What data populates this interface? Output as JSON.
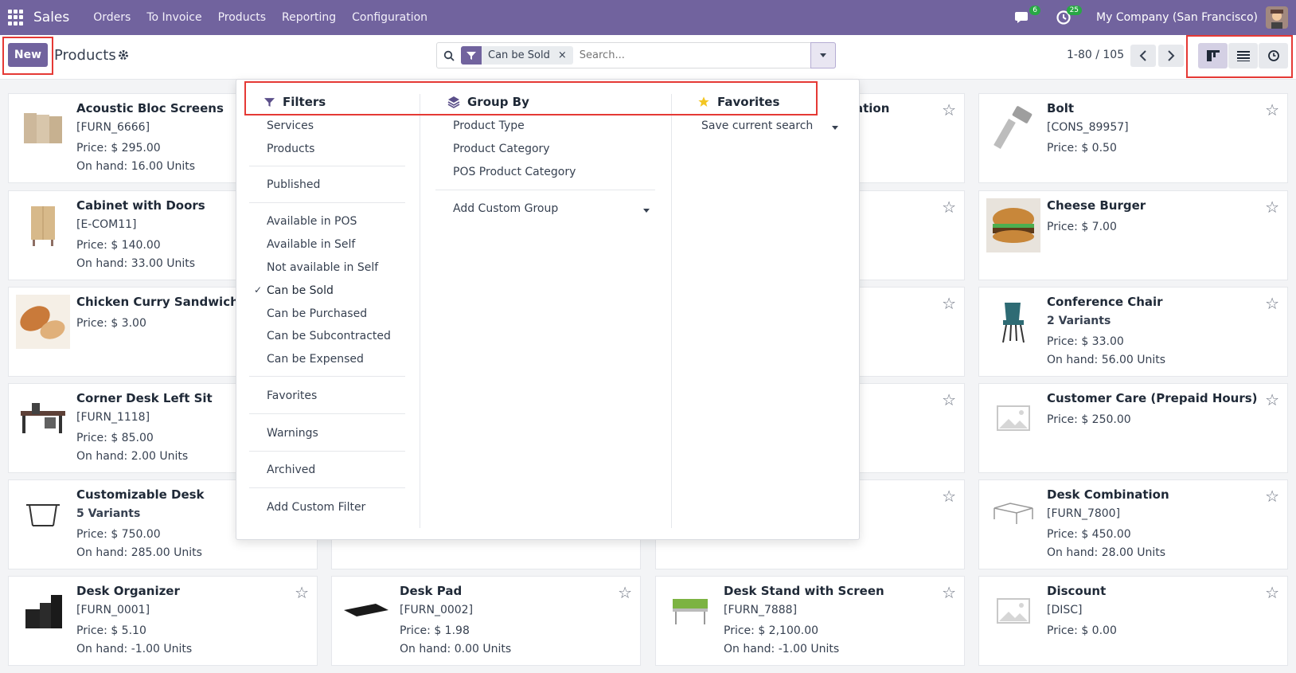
{
  "navbar": {
    "app_name": "Sales",
    "menu": [
      "Orders",
      "To Invoice",
      "Products",
      "Reporting",
      "Configuration"
    ],
    "messages_count": "6",
    "activities_count": "25",
    "company": "My Company (San Francisco)"
  },
  "control": {
    "new_label": "New",
    "title": "Products",
    "facet_label": "Can be Sold",
    "facet_remove": "×",
    "search_placeholder": "Search...",
    "pager": "1-80 / 105"
  },
  "dropdown": {
    "filters_title": "Filters",
    "groupby_title": "Group By",
    "favorites_title": "Favorites",
    "filters": {
      "services": "Services",
      "products": "Products",
      "published": "Published",
      "available_pos": "Available in POS",
      "available_self": "Available in Self",
      "not_available_self": "Not available in Self",
      "can_be_sold": "Can be Sold",
      "can_be_purchased": "Can be Purchased",
      "can_be_subcontracted": "Can be Subcontracted",
      "can_be_expensed": "Can be Expensed",
      "favorites": "Favorites",
      "warnings": "Warnings",
      "archived": "Archived",
      "add_custom_filter": "Add Custom Filter"
    },
    "groupby": {
      "product_type": "Product Type",
      "product_category": "Product Category",
      "pos_product_category": "POS Product Category",
      "add_custom_group": "Add Custom Group"
    },
    "favorites": {
      "save_current_search": "Save current search"
    },
    "check_mark": "✓"
  },
  "cards": {
    "c1": {
      "title": "Acoustic Bloc Screens",
      "ref": "[FURN_6666]",
      "price": "Price: $ 295.00",
      "onhand": "On hand: 16.00 Units"
    },
    "c2": {
      "title": "Bolt",
      "ref": "[CONS_89957]",
      "price": "Price: $ 0.50"
    },
    "c3": {
      "title": "Cabinet with Doors",
      "ref": "[E-COM11]",
      "price": "Price: $ 140.00",
      "onhand": "On hand: 33.00 Units"
    },
    "c4": {
      "title": "Cheese Burger",
      "price": "Price: $ 7.00"
    },
    "c5": {
      "title": "Chicken Curry Sandwich",
      "price": "Price: $ 3.00"
    },
    "c6": {
      "title": "Conference Chair",
      "variants": "2 Variants",
      "price": "Price: $ 33.00",
      "onhand": "On hand: 56.00 Units"
    },
    "c7": {
      "title": "Corner Desk Left Sit",
      "ref": "[FURN_1118]",
      "price": "Price: $ 85.00",
      "onhand": "On hand: 2.00 Units"
    },
    "c8": {
      "title": "Customer Care (Prepaid Hours)",
      "price": "Price: $ 250.00"
    },
    "c9": {
      "title": "Customizable Desk",
      "variants": "5 Variants",
      "price": "Price: $ 750.00",
      "onhand": "On hand: 285.00 Units"
    },
    "c10": {
      "title": "Desk Combination",
      "ref": "[FURN_7800]",
      "price": "Price: $ 450.00",
      "onhand": "On hand: 28.00 Units"
    },
    "c11": {
      "title": "Desk Organizer",
      "ref": "[FURN_0001]",
      "price": "Price: $ 5.10",
      "onhand": "On hand: -1.00 Units"
    },
    "c12": {
      "title": "Desk Pad",
      "ref": "[FURN_0002]",
      "price": "Price: $ 1.98",
      "onhand": "On hand: 0.00 Units"
    },
    "c13": {
      "title": "Desk Stand with Screen",
      "ref": "[FURN_7888]",
      "price": "Price: $ 2,100.00",
      "onhand": "On hand: -1.00 Units"
    },
    "c14": {
      "title": "Discount",
      "ref": "[DISC]",
      "price": "Price: $ 0.00"
    },
    "partial_title": "ation"
  },
  "colors": {
    "brand": "#71639e",
    "highlight": "#e53935",
    "favorite_star": "#f3c623"
  },
  "icons": [
    "apps-grid-icon",
    "chat-icon",
    "clock-icon",
    "gear-icon",
    "search-icon",
    "filter-icon",
    "caret-down-icon",
    "chevron-left-icon",
    "chevron-right-icon",
    "kanban-view-icon",
    "list-view-icon",
    "activity-view-icon",
    "layers-icon",
    "star-icon",
    "check-icon"
  ]
}
